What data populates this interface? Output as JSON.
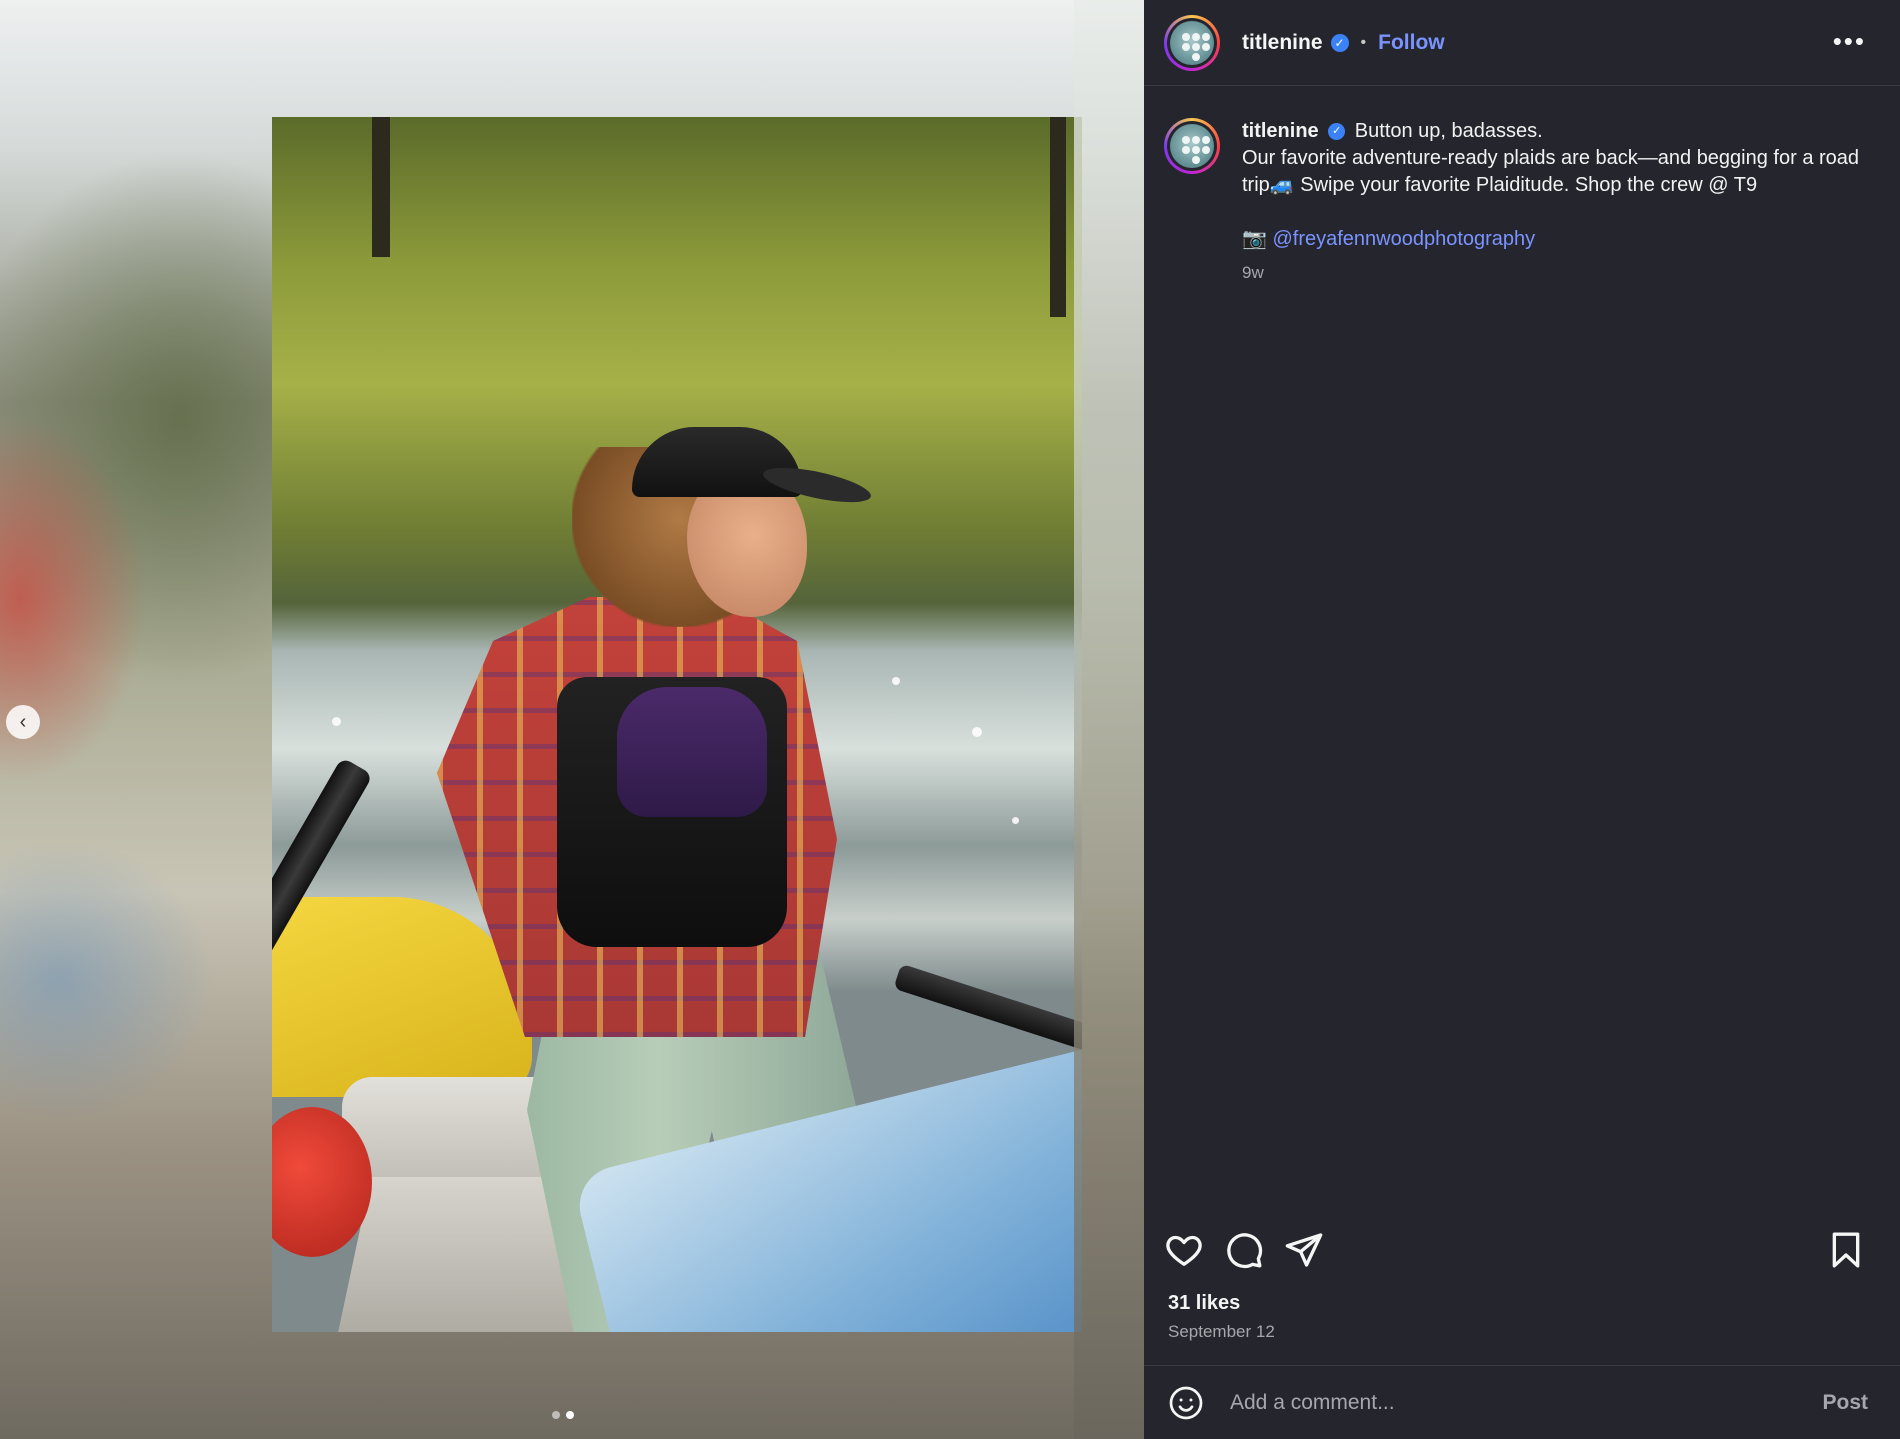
{
  "post": {
    "username": "titlenine",
    "separator": "•",
    "follow_label": "Follow",
    "more_label": "•••",
    "verified_glyph": "✓"
  },
  "caption": {
    "username": "titlenine",
    "headline": "Button up, badasses.",
    "body": "Our favorite adventure-ready plaids are back—and begging for a road trip🚙 Swipe your favorite Plaiditude. Shop the crew @ T9",
    "camera_glyph": "📷",
    "mention": "@freyafennwoodphotography",
    "age": "9w"
  },
  "engagement": {
    "likes": "31 likes",
    "date": "September 12"
  },
  "comment": {
    "placeholder": "Add a comment...",
    "post_label": "Post"
  },
  "carousel": {
    "prev_glyph": "‹",
    "total": 2,
    "current": 2
  },
  "icons": {
    "like": "heart-icon",
    "comment": "comment-bubble-icon",
    "share": "paper-plane-icon",
    "save": "bookmark-icon",
    "emoji": "smiley-icon",
    "more": "more-options-icon",
    "verified": "verified-badge-icon"
  },
  "colors": {
    "panel_bg": "#25262d",
    "link_blue": "#7b93ff",
    "verified_blue": "#3b82f6"
  }
}
